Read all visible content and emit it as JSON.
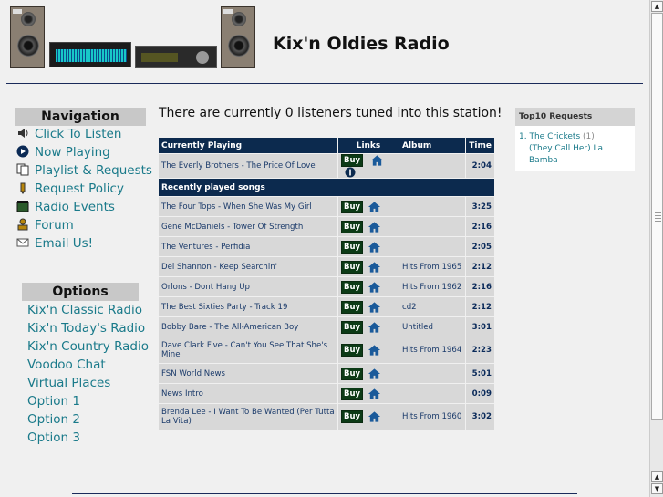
{
  "site": {
    "title": "Kix'n Oldies Radio"
  },
  "navigation": {
    "title": "Navigation",
    "items": [
      {
        "label": "Click To Listen",
        "icon": "speaker-icon"
      },
      {
        "label": "Now Playing",
        "icon": "play-circle-icon"
      },
      {
        "label": "Playlist & Requests",
        "icon": "copy-pages-icon"
      },
      {
        "label": "Request Policy",
        "icon": "pen-icon"
      },
      {
        "label": "Radio Events",
        "icon": "calendar-icon"
      },
      {
        "label": "Forum",
        "icon": "people-icon"
      },
      {
        "label": "Email Us!",
        "icon": "envelope-icon"
      }
    ]
  },
  "options": {
    "title": "Options",
    "items": [
      "Kix'n Classic Radio",
      "Kix'n Today's Radio",
      "Kix'n Country Radio",
      "Voodoo Chat",
      "Virtual Places",
      "Option 1",
      "Option 2",
      "Option 3"
    ]
  },
  "listeners_text": "There are currently 0 listeners tuned into this station!",
  "table": {
    "headers": {
      "current": "Currently Playing",
      "links": "Links",
      "album": "Album",
      "time": "Time"
    },
    "buy_label": "Buy",
    "current": {
      "title": "The Everly Brothers - The Price Of Love",
      "album": "",
      "time": "2:04"
    },
    "recent_label": "Recently played songs",
    "recent": [
      {
        "title": "The Four Tops - When She Was My Girl",
        "album": "",
        "time": "3:25"
      },
      {
        "title": "Gene McDaniels - Tower Of Strength",
        "album": "",
        "time": "2:16"
      },
      {
        "title": "The Ventures - Perfidia",
        "album": "",
        "time": "2:05"
      },
      {
        "title": "Del Shannon - Keep Searchin'",
        "album": "Hits From 1965",
        "time": "2:12"
      },
      {
        "title": "Orlons - Dont Hang Up",
        "album": "Hits From 1962",
        "time": "2:16"
      },
      {
        "title": "The Best Sixties Party - Track 19",
        "album": "cd2",
        "time": "2:12"
      },
      {
        "title": "Bobby Bare - The All-American Boy",
        "album": "Untitled",
        "time": "3:01"
      },
      {
        "title": "Dave Clark Five - Can't You See That She's Mine",
        "album": "Hits From 1964",
        "time": "2:23"
      },
      {
        "title": "FSN World News",
        "album": "",
        "time": "5:01"
      },
      {
        "title": "News Intro",
        "album": "",
        "time": "0:09"
      },
      {
        "title": "Brenda Lee - I Want To Be Wanted (Per Tutta La Vita)",
        "album": "Hits From 1960",
        "time": "3:02"
      }
    ]
  },
  "top10": {
    "title": "Top10 Requests",
    "items": [
      {
        "rank": "1.",
        "artist": "The Crickets",
        "count": "(1)",
        "song": "(They Call Her) La Bamba"
      }
    ]
  },
  "colors": {
    "header_bg": "#0c2a4e",
    "link": "#1a7a8a",
    "buy_bg": "#0c3a16",
    "row_bg": "#d8d8d8"
  }
}
